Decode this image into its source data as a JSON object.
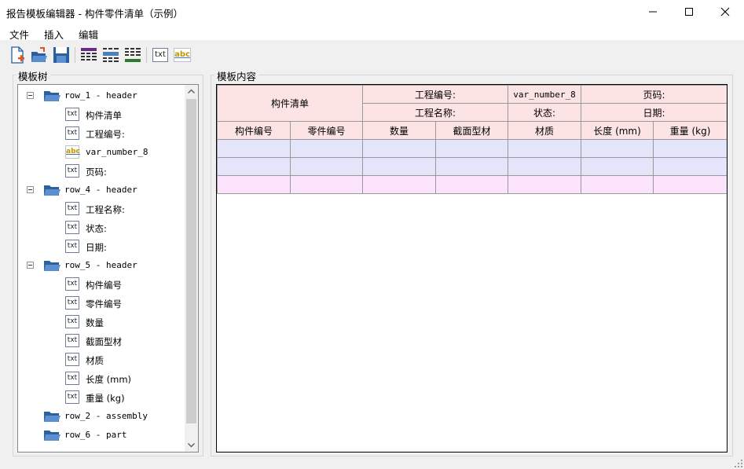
{
  "window": {
    "title": "报告模板编辑器 - 构件零件清单（示例）"
  },
  "menu": [
    "文件",
    "插入",
    "编辑"
  ],
  "toolbar": {
    "buttons": [
      "new-file-icon",
      "open-folder-icon",
      "save-icon",
      "table-purple-icon",
      "table-blue-icon",
      "table-green-icon",
      "text-icon",
      "variable-icon"
    ],
    "text_label": "txt",
    "var_label": "abc"
  },
  "tree_panel": {
    "title": "模板树",
    "rows": [
      {
        "type": "node",
        "label": "row_1 - header"
      },
      {
        "type": "txt",
        "label": "构件清单"
      },
      {
        "type": "txt",
        "label": "工程编号:"
      },
      {
        "type": "var",
        "label": "var_number_8"
      },
      {
        "type": "txt",
        "label": "页码:"
      },
      {
        "type": "node",
        "label": "row_4 - header"
      },
      {
        "type": "txt",
        "label": "工程名称:"
      },
      {
        "type": "txt",
        "label": "状态:"
      },
      {
        "type": "txt",
        "label": "日期:"
      },
      {
        "type": "node",
        "label": "row_5 - header"
      },
      {
        "type": "txt",
        "label": "构件编号"
      },
      {
        "type": "txt",
        "label": "零件编号"
      },
      {
        "type": "txt",
        "label": "数量"
      },
      {
        "type": "txt",
        "label": "截面型材"
      },
      {
        "type": "txt",
        "label": "材质"
      },
      {
        "type": "txt",
        "label": "长度 (mm)"
      },
      {
        "type": "txt",
        "label": "重量 (kg)"
      },
      {
        "type": "folder",
        "label": "row_2 - assembly"
      },
      {
        "type": "folder",
        "label": "row_6 - part"
      }
    ]
  },
  "content_panel": {
    "title": "模板内容",
    "header": {
      "title_cell": "构件清单",
      "project_no_label": "工程编号:",
      "project_no_var": "var_number_8",
      "page_label": "页码:",
      "project_name_label": "工程名称:",
      "status_label": "状态:",
      "date_label": "日期:"
    },
    "columns": [
      "构件编号",
      "零件编号",
      "数量",
      "截面型材",
      "材质",
      "长度 (mm)",
      "重量 (kg)"
    ]
  },
  "colors": {
    "header_row": "#fde4e4",
    "assembly_row": "#e4e4fb",
    "part_row": "#fbe4fb"
  }
}
